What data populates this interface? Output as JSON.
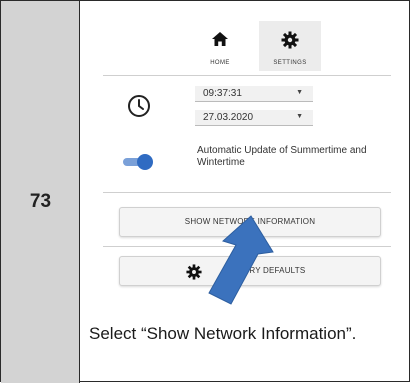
{
  "step": {
    "number": "73"
  },
  "tabs": [
    {
      "label": "HOME",
      "icon": "home-icon"
    },
    {
      "label": "SETTINGS",
      "icon": "gear-icon"
    }
  ],
  "settings": {
    "time_value": "09:37:31",
    "date_value": "27.03.2020",
    "auto_update_label": "Automatic Update of Summertime and Wintertime",
    "auto_update_enabled": true
  },
  "buttons": {
    "show_network": "SHOW NETWORK INFORMATION",
    "factory_defaults": "TORY DEFAULTS"
  },
  "instruction": "Select “Show Network Information”.",
  "colors": {
    "accent": "#2f6bc2",
    "arrow": "#3b72bd",
    "step_bg": "#d3d3d3"
  }
}
